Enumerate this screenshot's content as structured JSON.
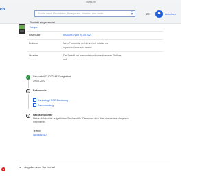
{
  "browser": {
    "url": "digitec.ch"
  },
  "header": {
    "brand": "ch",
    "search_placeholder": "Suche nach Produkten, Kategorien, Marken und mehr",
    "language": "DE",
    "user_label": "Anmelden"
  },
  "product": {
    "title": "Produkt eingesendet",
    "subtitle": "Europa"
  },
  "table": {
    "rows": [
      {
        "label": "Bestellung",
        "value": "#9208447 vom 20.08.2021",
        "is_link": true
      },
      {
        "label": "Problem",
        "value": "Mein Produkt ist defekt und ich möchte es reparieren/ersetzen lassen",
        "is_link": false
      },
      {
        "label": "Ursache",
        "value": "Der Defekt trat unerwartet und ohne äusseren Einfluss auf.",
        "is_link": false
      }
    ]
  },
  "timeline": {
    "registered_title": "Servicefall CUC0024870 registriert",
    "registered_date": "29.06.2022",
    "documents_title": "Dokumente",
    "documents": [
      "Kaufbeleg / PDF-Rechnung",
      "Serviceauftrag"
    ],
    "next_title": "Nächste Schritte",
    "next_text": "Melde dich bei der aufgeführten Servicestelle. Diese wird dich über das weitere Vorgehen informieren.",
    "phone_label": "Telefon",
    "phone": "0825851010"
  },
  "details_toggle": "Angaben zum Servicefall",
  "colors": {
    "accent": "#1f5dd6",
    "success": "#1f8f3a",
    "badge": "#e02020"
  }
}
